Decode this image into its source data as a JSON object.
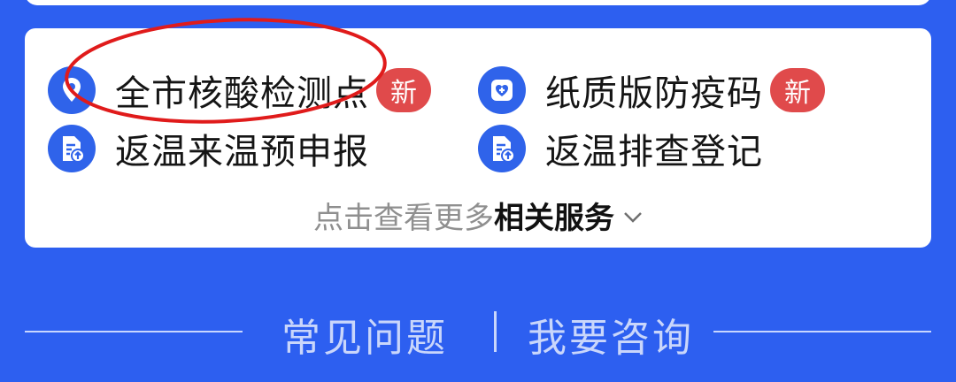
{
  "colors": {
    "background": "#2d5ff0",
    "card": "#ffffff",
    "icon_bg": "#2f63ea",
    "badge": "#e04a4b",
    "annotation": "#e01b1b",
    "faq_text": "#c9d6fb"
  },
  "services": {
    "items": [
      {
        "label": "全市核酸检测点",
        "icon": "location-pin-icon",
        "badge": "新"
      },
      {
        "label": "纸质版防疫码",
        "icon": "health-code-icon",
        "badge": "新"
      },
      {
        "label": "返温来温预申报",
        "icon": "document-upload-icon"
      },
      {
        "label": "返温排查登记",
        "icon": "document-upload-icon"
      }
    ],
    "more": {
      "prefix": "点击查看更多",
      "strong": "相关服务",
      "icon": "chevron-down-icon"
    }
  },
  "footer": {
    "faq_label": "常见问题",
    "consult_label": "我要咨询"
  }
}
